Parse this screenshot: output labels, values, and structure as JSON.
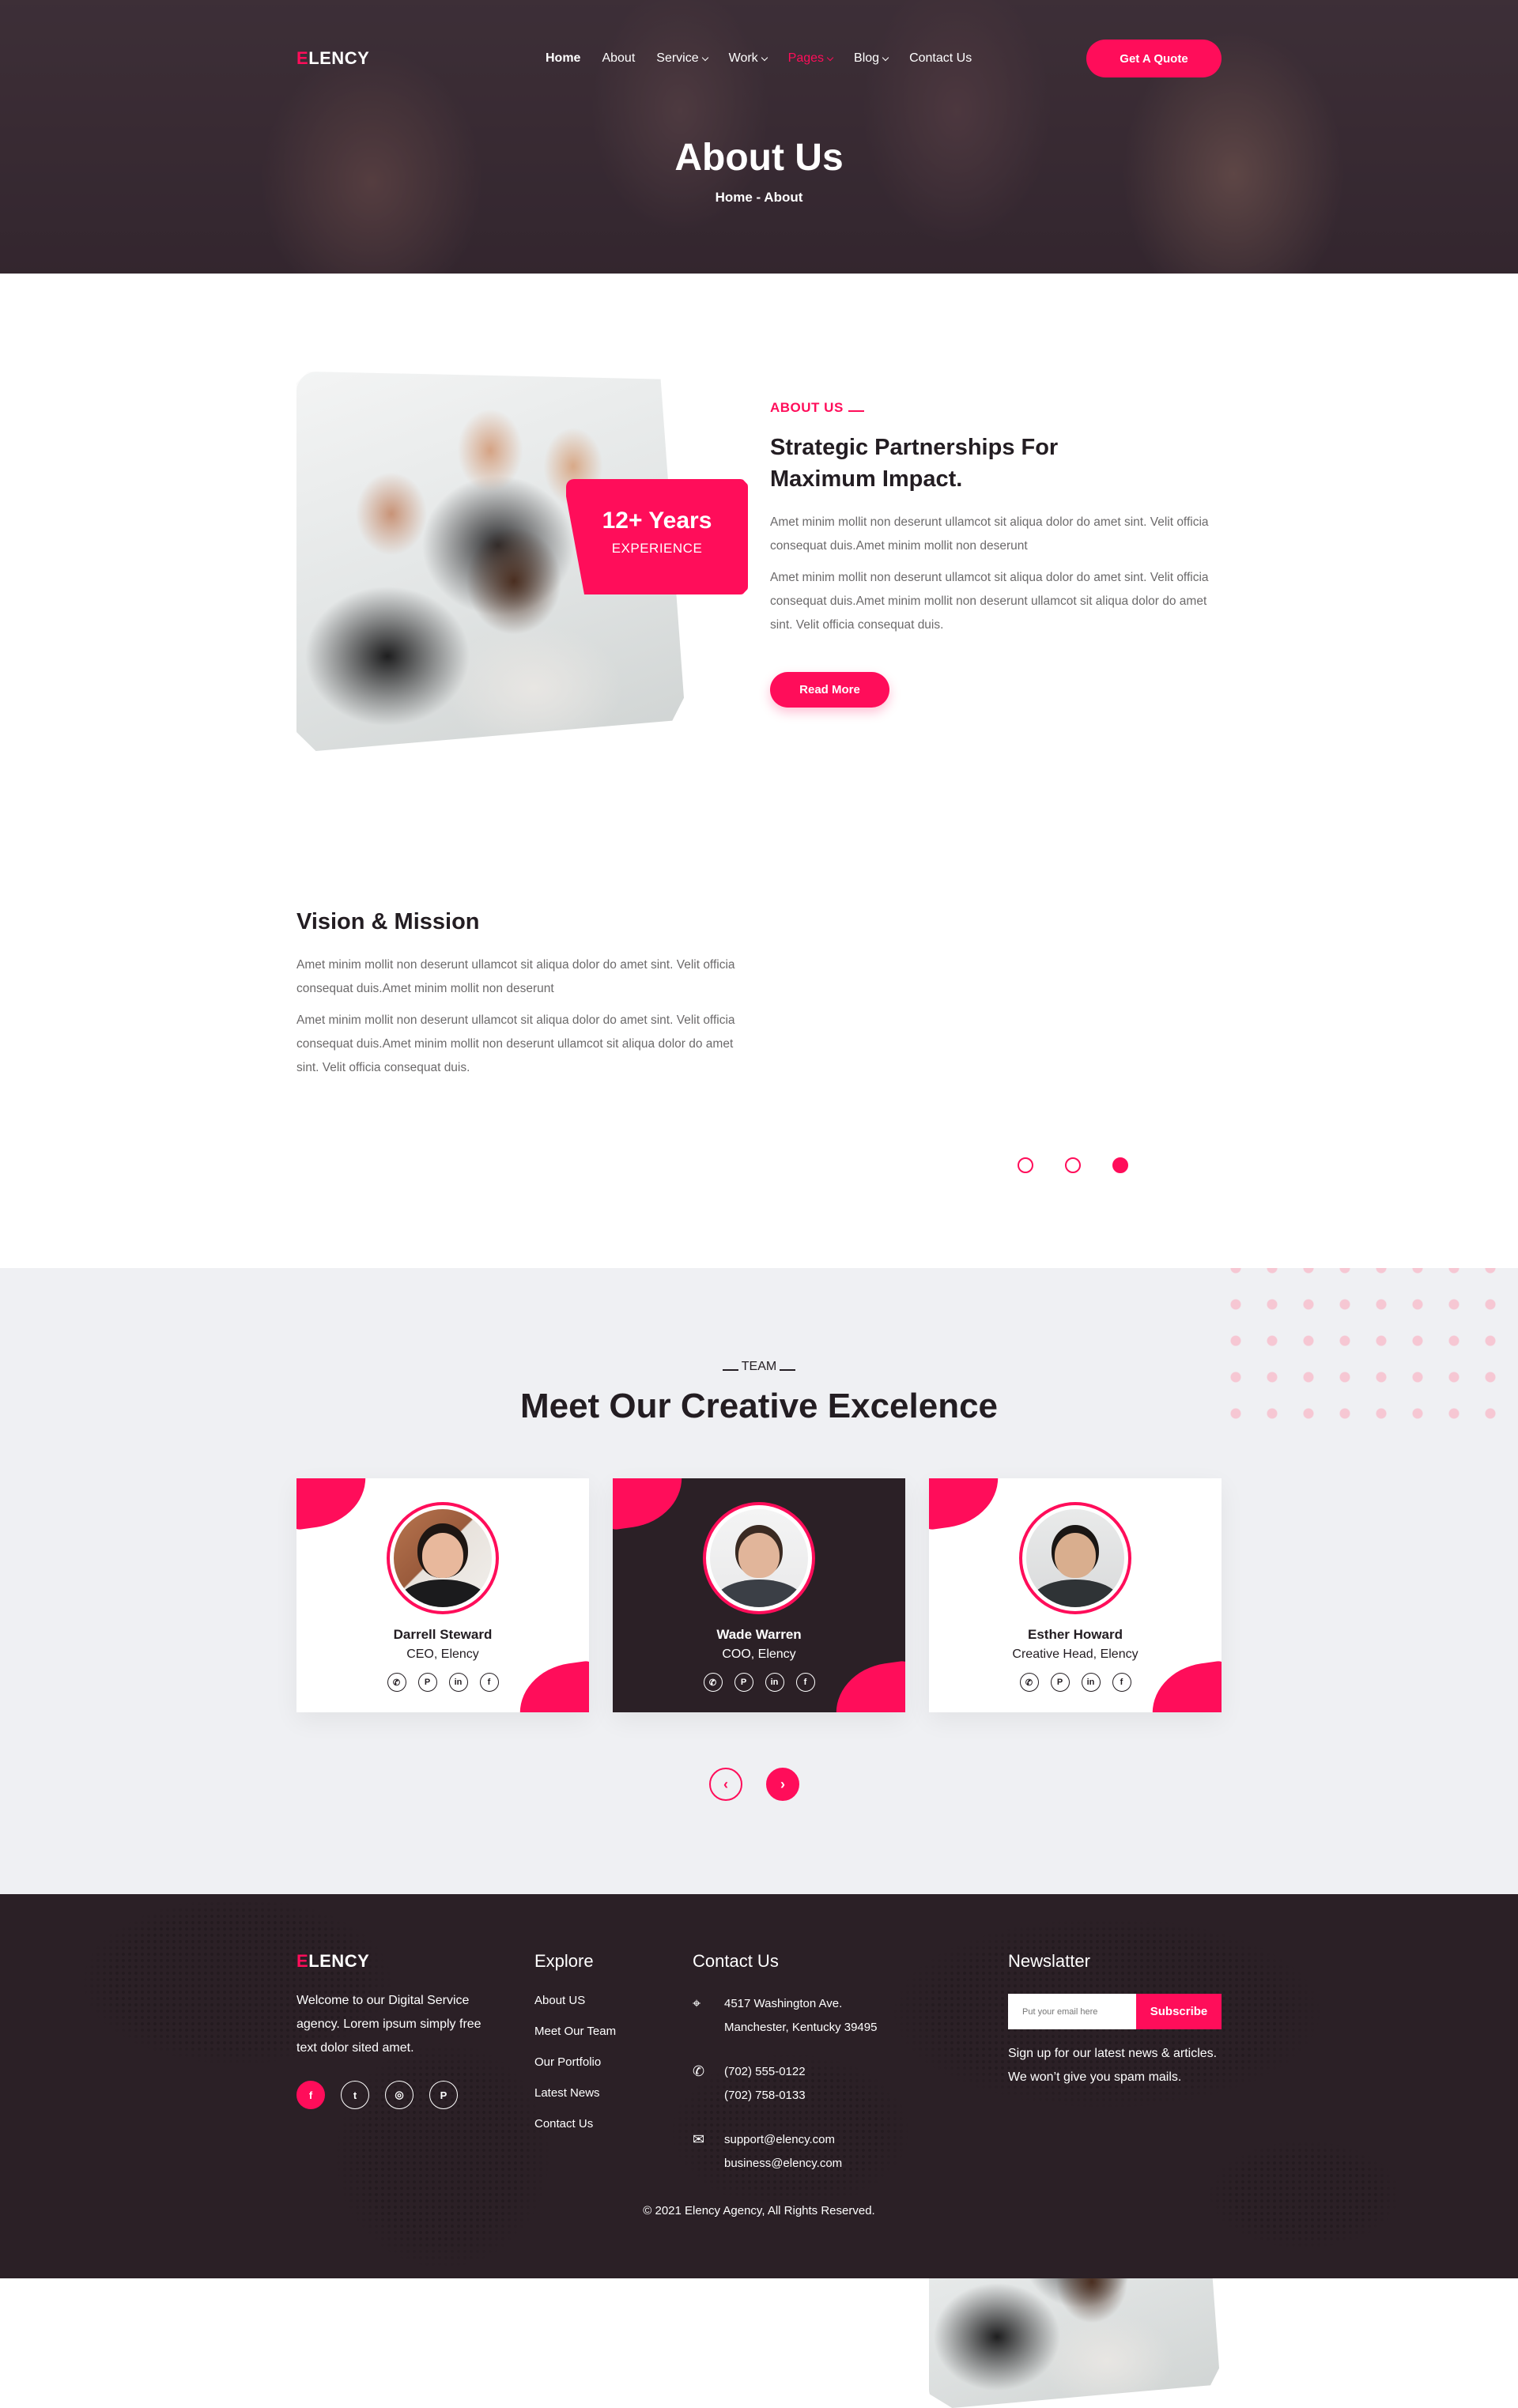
{
  "header": {
    "logo_accent": "E",
    "logo_rest": "LENCY",
    "nav": [
      {
        "label": "Home"
      },
      {
        "label": "About"
      },
      {
        "label": "Service"
      },
      {
        "label": "Work"
      },
      {
        "label": "Pages"
      },
      {
        "label": "Blog"
      },
      {
        "label": "Contact Us"
      }
    ],
    "cta": "Get A Quote",
    "title": "About Us",
    "breadcrumb": "Home - About"
  },
  "about": {
    "experience_number": "12+ Years",
    "experience_label": "EXPERIENCE",
    "eyebrow": "ABOUT  US",
    "heading_line1": "Strategic Partnerships For",
    "heading_line2": "Maximum Impact.",
    "para1": "Amet minim mollit non deserunt ullamcot sit aliqua dolor do amet sint. Velit officia consequat duis.Amet minim mollit non deserunt",
    "para2": "Amet minim mollit non deserunt ullamcot sit aliqua dolor do amet sint. Velit officia consequat duis.Amet minim mollit non deserunt ullamcot sit aliqua dolor do amet sint. Velit officia consequat duis.",
    "button": "Read More"
  },
  "vision": {
    "heading": "Vision & Mission",
    "para1": "Amet minim mollit non deserunt ullamcot sit aliqua dolor do amet sint. Velit officia consequat duis.Amet minim mollit non deserunt",
    "para2": "Amet minim mollit non deserunt ullamcot sit aliqua dolor do amet sint. Velit officia consequat duis.Amet minim mollit non deserunt ullamcot sit aliqua dolor do amet sint. Velit officia consequat duis.",
    "slider_active_index": 2
  },
  "team": {
    "eyebrow": "TEAM",
    "title": "Meet Our Creative Excelence",
    "members": [
      {
        "name": "Darrell Steward",
        "role": "CEO, Elency"
      },
      {
        "name": "Wade Warren",
        "role": "COO, Elency"
      },
      {
        "name": "Esther Howard",
        "role": "Creative Head, Elency"
      }
    ],
    "social_icons": [
      "whatsapp-icon",
      "pinterest-icon",
      "linkedin-icon",
      "facebook-icon"
    ]
  },
  "footer": {
    "logo_accent": "E",
    "logo_rest": "LENCY",
    "about_text": "Welcome to our Digital Service agency. Lorem ipsum simply free text dolor sited amet.",
    "explore_title": "Explore",
    "explore_links": [
      "About US",
      "Meet Our Team",
      "Our Portfolio",
      "Latest News",
      "Contact Us"
    ],
    "contact_title": "Contact Us",
    "address_line1": "4517 Washington Ave.",
    "address_line2": "Manchester, Kentucky 39495",
    "phone1": "(702) 555-0122",
    "phone2": "(702) 758-0133",
    "email1": "support@elency.com",
    "email2": "business@elency.com",
    "newsletter_title": "Newslatter",
    "newsletter_placeholder": "Put your email here",
    "newsletter_button": "Subscribe",
    "newsletter_text": "Sign up for our latest news & articles. We won’t give you spam mails.",
    "copyright": "© 2021 Elency Agency, All Rights Reserved."
  },
  "colors": {
    "accent": "#ff0d5a",
    "dark": "#2b2026",
    "team_bg": "#eff0f3"
  }
}
